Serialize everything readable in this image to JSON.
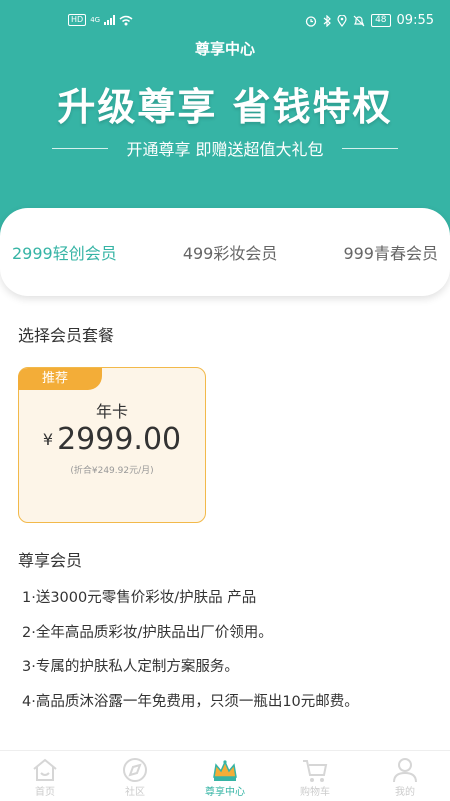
{
  "status_bar": {
    "network_badge": "HD",
    "network_type": "4G",
    "battery": "48",
    "time": "09:55"
  },
  "header": {
    "title": "尊享中心"
  },
  "hero": {
    "title": "升级尊享 省钱特权",
    "subtitle": "开通尊享 即赠送超值大礼包"
  },
  "tabs": [
    {
      "label": "2999轻创会员",
      "active": true
    },
    {
      "label": "499彩妆会员",
      "active": false
    },
    {
      "label": "999青春会员",
      "active": false
    }
  ],
  "plan_section": {
    "title": "选择会员套餐"
  },
  "plan": {
    "badge": "推荐",
    "name": "年卡",
    "currency": "¥",
    "price": "2999.00",
    "note": "(折合¥249.92元/月)"
  },
  "benefits_section": {
    "title": "尊享会员",
    "items": [
      "1·送3000元零售价彩妆/护肤品 产品",
      "2·全年高品质彩妆/护肤品出厂价领用。",
      "3·专属的护肤私人定制方案服务。",
      "4·高品质沐浴露一年免费用，只须一瓶出10元邮费。"
    ]
  },
  "bottom_nav": [
    {
      "label": "首页",
      "icon": "home-icon",
      "active": false
    },
    {
      "label": "社区",
      "icon": "community-icon",
      "active": false
    },
    {
      "label": "尊享中心",
      "icon": "crown-icon",
      "active": true
    },
    {
      "label": "购物车",
      "icon": "cart-icon",
      "active": false
    },
    {
      "label": "我的",
      "icon": "profile-icon",
      "active": false
    }
  ],
  "colors": {
    "primary": "#36b4a5",
    "plan_border": "#f2b94a",
    "badge": "#f3ad38",
    "plan_bg": "#fdf5e8"
  }
}
